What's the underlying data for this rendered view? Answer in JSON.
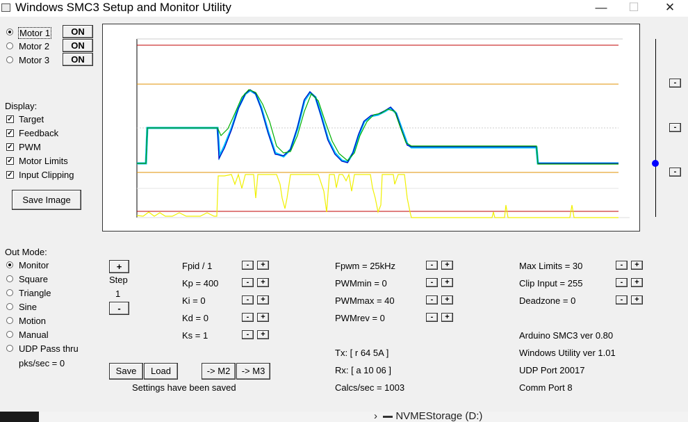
{
  "window": {
    "title": "Windows SMC3 Setup and Monitor Utility",
    "minimize_glyph": "—",
    "maximize_glyph": "☐",
    "close_glyph": "✕"
  },
  "motors": [
    {
      "label": "Motor 1",
      "button": "ON",
      "selected": true
    },
    {
      "label": "Motor 2",
      "button": "ON",
      "selected": false
    },
    {
      "label": "Motor 3",
      "button": "ON",
      "selected": false
    }
  ],
  "display": {
    "heading": "Display:",
    "items": [
      {
        "label": "Target",
        "checked": true
      },
      {
        "label": "Feedback",
        "checked": true
      },
      {
        "label": "PWM",
        "checked": true
      },
      {
        "label": "Motor Limits",
        "checked": true
      },
      {
        "label": "Input Clipping",
        "checked": true
      }
    ],
    "save_image": "Save Image"
  },
  "out_mode": {
    "heading": "Out Mode:",
    "options": [
      {
        "label": "Monitor",
        "selected": true
      },
      {
        "label": "Square",
        "selected": false
      },
      {
        "label": "Triangle",
        "selected": false
      },
      {
        "label": "Sine",
        "selected": false
      },
      {
        "label": "Motion",
        "selected": false
      },
      {
        "label": "Manual",
        "selected": false
      },
      {
        "label": "UDP Pass thru",
        "selected": false
      }
    ],
    "pks_sec": "pks/sec = 0"
  },
  "step": {
    "plus": "+",
    "label": "Step",
    "value": "1",
    "minus": "-"
  },
  "pid": {
    "fpid": "Fpid / 1",
    "kp": "Kp = 400",
    "ki": "Ki = 0",
    "kd": "Kd = 0",
    "ks": "Ks = 1"
  },
  "pwm": {
    "fpwm": "Fpwm = 25kHz",
    "pwmmin": "PWMmin = 0",
    "pwmmax": "PWMmax = 40",
    "pwmrev": "PWMrev = 0"
  },
  "limits": {
    "max_limits": "Max Limits = 30",
    "clip_input": "Clip Input = 255",
    "deadzone": "Deadzone = 0"
  },
  "spin": {
    "minus": "-",
    "plus": "+"
  },
  "comms": {
    "tx": "Tx: [ r 64 5A ]",
    "rx": "Rx: [ a 10 06 ]",
    "calcs": "Calcs/sec = 1003"
  },
  "info": {
    "arduino": "Arduino SMC3 ver 0.80",
    "utility": "Windows Utility ver 1.01",
    "udp": "UDP Port 20017",
    "comm": "Comm Port 8"
  },
  "settings": {
    "save": "Save",
    "load": "Load",
    "to_m2": "-> M2",
    "to_m3": "-> M3",
    "status": "Settings have been saved"
  },
  "right_slider": {
    "btn": "-",
    "level": 0.3
  },
  "taskbar": {
    "label": "NVMEStorage (D:)"
  },
  "colors": {
    "target": "#00b000",
    "feedback": "#0000c0",
    "feedback_outline": "#00c0ff",
    "pwm": "#f0f000",
    "limits_red": "#c00000",
    "limits_orange": "#e09000",
    "slider_thumb": "#0000ff"
  }
}
